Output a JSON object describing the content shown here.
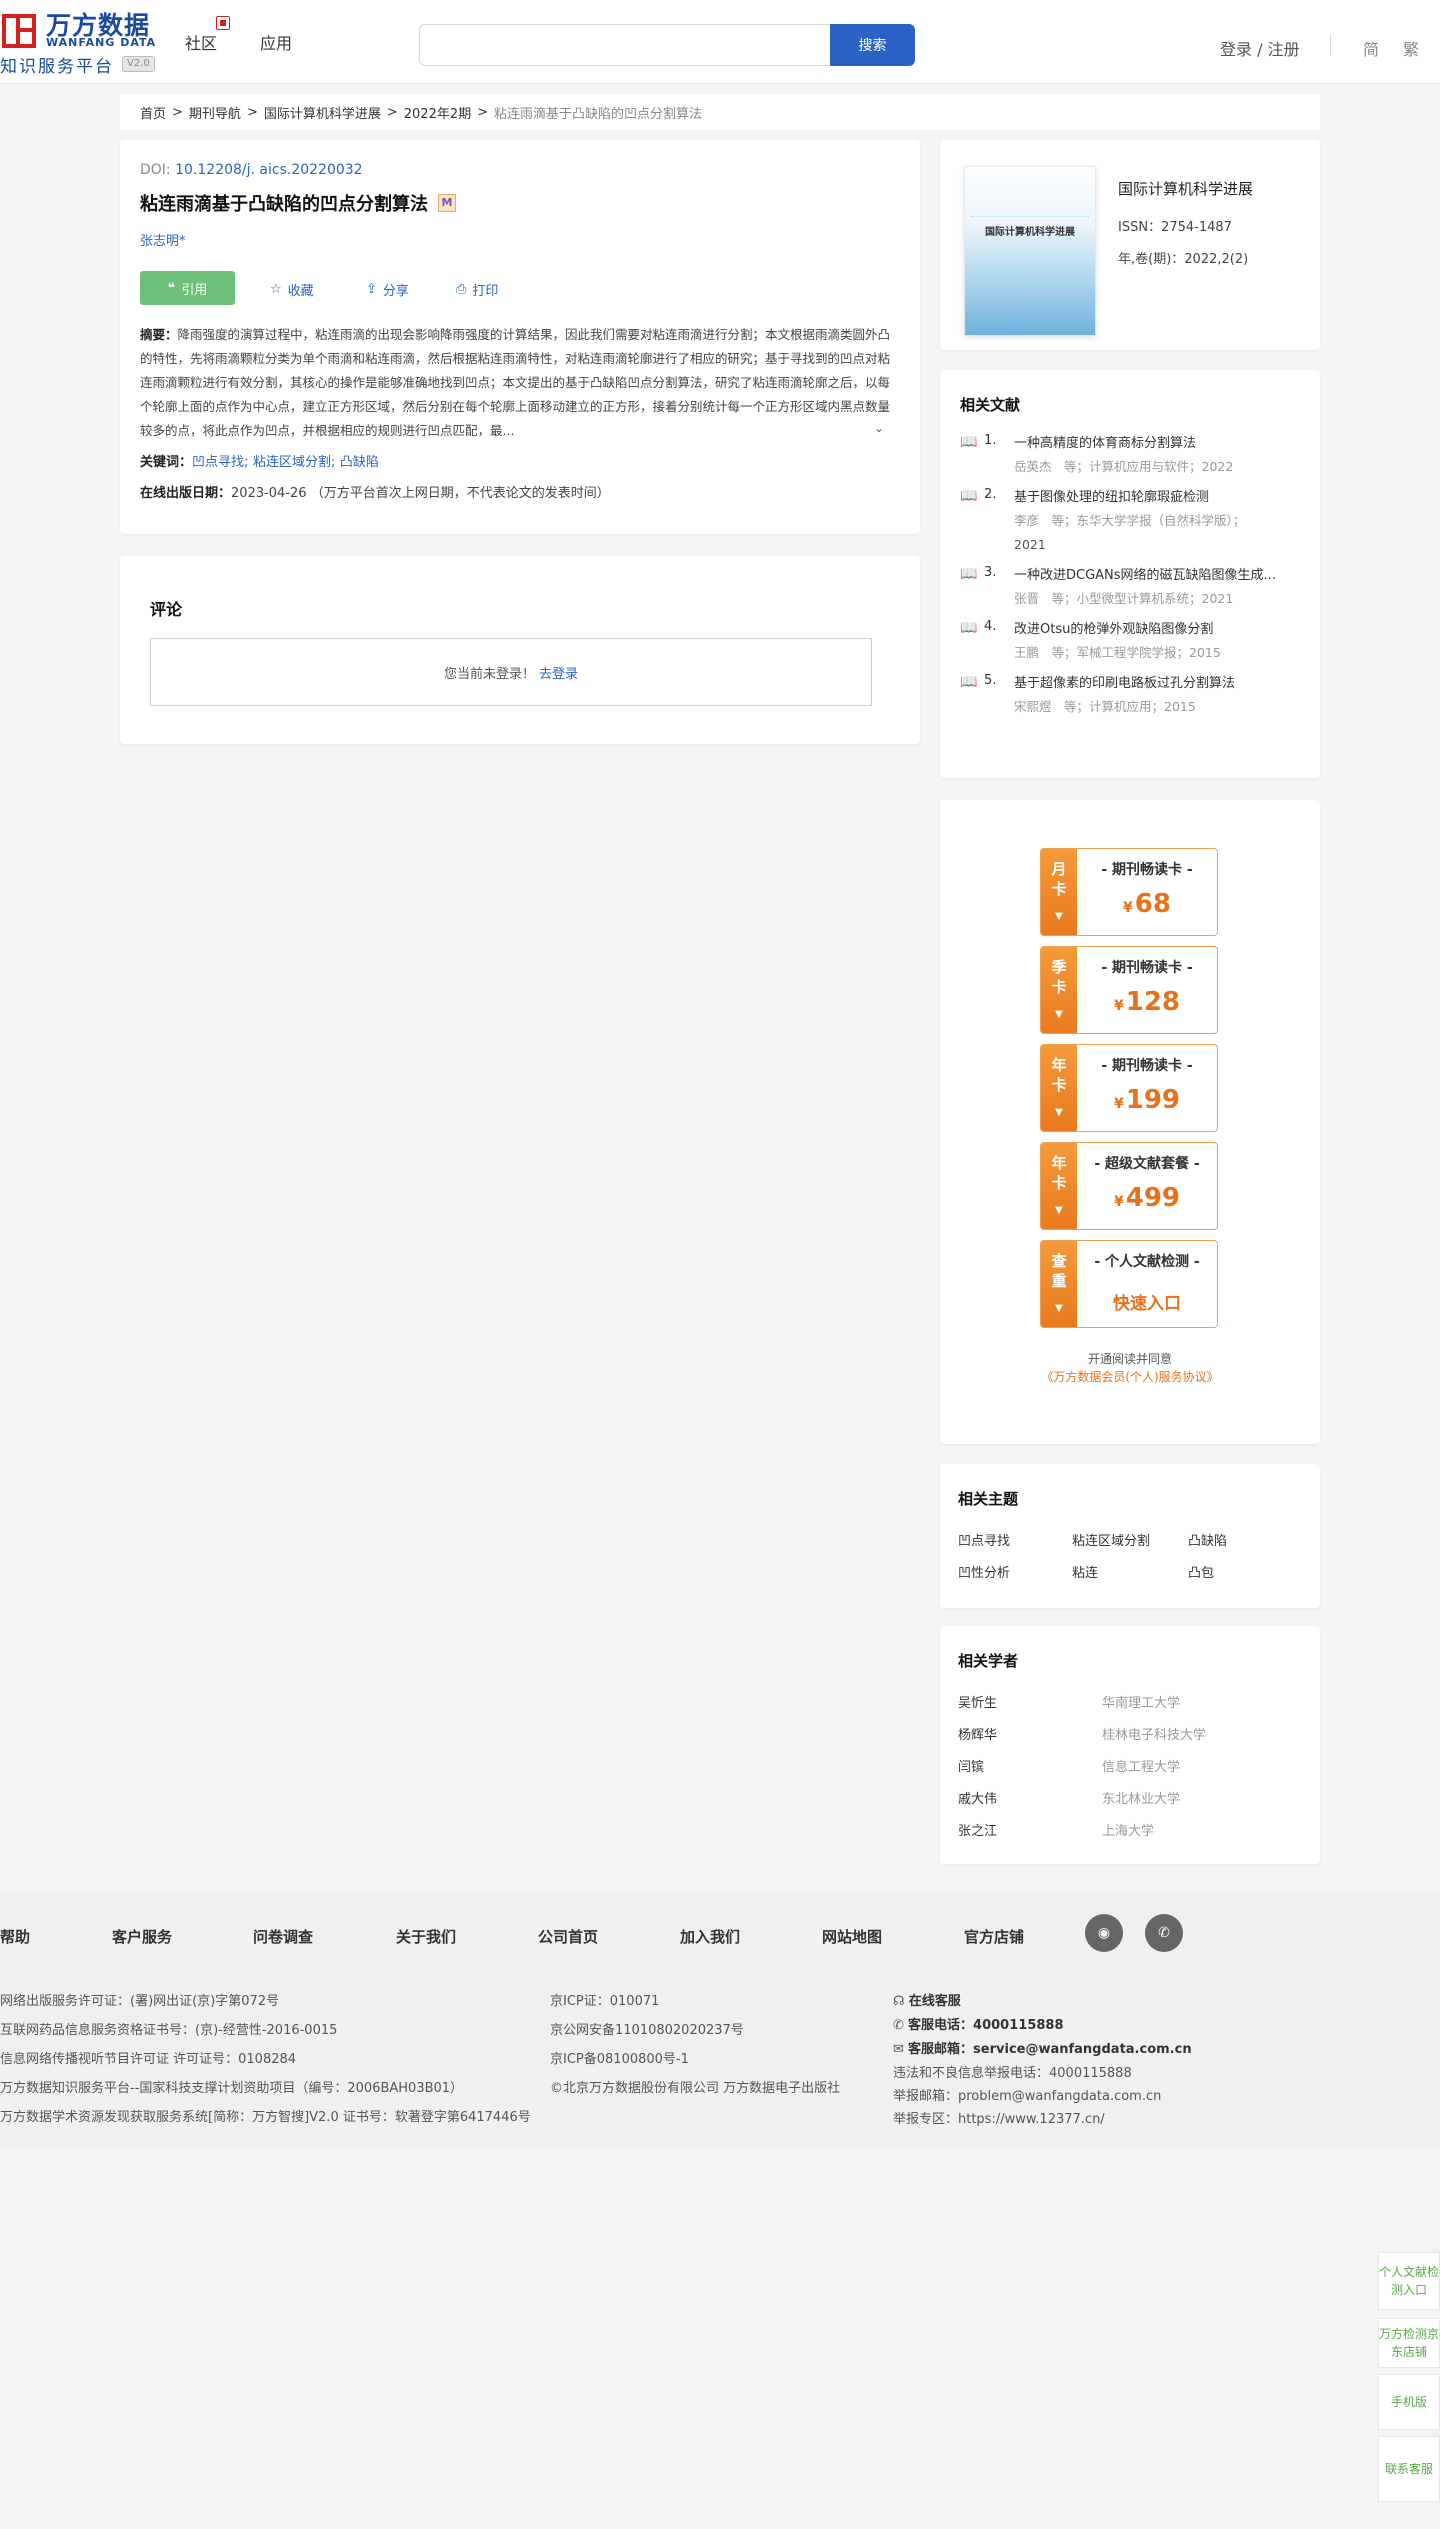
{
  "header": {
    "logo_cn": "万方数据",
    "logo_en": "WANFANG DATA",
    "logo_sub": "知识服务平台",
    "logo_version": "V2.0",
    "nav": {
      "community": "社区",
      "apps": "应用"
    },
    "search": {
      "placeholder": "",
      "button": "搜索"
    },
    "login": "登录 / 注册",
    "lang_simplified": "简",
    "lang_traditional": "繁"
  },
  "breadcrumb": [
    "首页",
    "期刊导航",
    "国际计算机科学进展",
    "2022年2期",
    "粘连雨滴基于凸缺陷的凹点分割算法"
  ],
  "article": {
    "doi_label": "DOI: ",
    "doi": "10.12208/j. aics.20220032",
    "title": "粘连雨滴基于凸缺陷的凹点分割算法",
    "badge": "M",
    "author": "张志明*",
    "actions": {
      "cite": "引用",
      "collect": "收藏",
      "share": "分享",
      "print": "打印"
    },
    "abstract_label": "摘要：",
    "abstract": "降雨强度的演算过程中，粘连雨滴的出现会影响降雨强度的计算结果，因此我们需要对粘连雨滴进行分割；本文根据雨滴类圆外凸的特性，先将雨滴颗粒分类为单个雨滴和粘连雨滴，然后根据粘连雨滴特性，对粘连雨滴轮廓进行了相应的研究；基于寻找到的凹点对粘连雨滴颗粒进行有效分割，其核心的操作是能够准确地找到凹点；本文提出的基于凸缺陷凹点分割算法，研究了粘连雨滴轮廓之后，以每个轮廓上面的点作为中心点，建立正方形区域，然后分别在每个轮廓上面移动建立的正方形，接着分别统计每一个正方形区域内黑点数量较多的点，将此点作为凹点，并根据相应的规则进行凹点匹配，最...",
    "keywords_label": "关键词：",
    "keywords": [
      "凹点寻找;",
      "粘连区域分割;",
      "凸缺陷"
    ],
    "pubdate_label": "在线出版日期：",
    "pubdate": "2023-04-26 （万方平台首次上网日期，不代表论文的发表时间）"
  },
  "comments": {
    "title": "评论",
    "not_logged": "您当前未登录！",
    "login_link": "去登录"
  },
  "journal": {
    "cover_title": "国际计算机科学进展",
    "name": "国际计算机科学进展",
    "issn": "ISSN：2754-1487",
    "year": "年,卷(期)：2022,2(2)"
  },
  "related_docs": {
    "title": "相关文献",
    "items": [
      {
        "num": "1.",
        "title": "一种高精度的体育商标分割算法",
        "meta": "岳英杰　等；计算机应用与软件；2022"
      },
      {
        "num": "2.",
        "title": "基于图像处理的纽扣轮廓瑕疵检测",
        "meta": "李彦　等；东华大学学报（自然科学版）；",
        "meta2": "2021"
      },
      {
        "num": "3.",
        "title": "一种改进DCGANs网络的磁瓦缺陷图像生成...",
        "meta": "张晋　等；小型微型计算机系统；2021"
      },
      {
        "num": "4.",
        "title": "改进Otsu的枪弹外观缺陷图像分割",
        "meta": "王鹏　等；军械工程学院学报；2015"
      },
      {
        "num": "5.",
        "title": "基于超像素的印刷电路板过孔分割算法",
        "meta": "宋熙煜　等；计算机应用；2015"
      }
    ]
  },
  "membership": {
    "cards": [
      {
        "side": "月卡",
        "head": "- 期刊畅读卡 -",
        "currency": "¥",
        "price": "68"
      },
      {
        "side": "季卡",
        "head": "- 期刊畅读卡 -",
        "currency": "¥",
        "price": "128"
      },
      {
        "side": "年卡",
        "head": "- 期刊畅读卡 -",
        "currency": "¥",
        "price": "199"
      },
      {
        "side": "年卡",
        "head": "- 超级文献套餐 -",
        "currency": "¥",
        "price": "499"
      },
      {
        "side": "查重",
        "head": "- 个人文献检测 -",
        "entry": "快速入口"
      }
    ],
    "note": "开通阅读并同意",
    "agreement": "《万方数据会员(个人)服务协议》"
  },
  "topics": {
    "title": "相关主题",
    "items": [
      "凹点寻找",
      "粘连区域分割",
      "凸缺陷",
      "凹性分析",
      "粘连",
      "凸包"
    ]
  },
  "scholars": {
    "title": "相关学者",
    "items": [
      {
        "name": "吴忻生",
        "org": "华南理工大学"
      },
      {
        "name": "杨辉华",
        "org": "桂林电子科技大学"
      },
      {
        "name": "闫镔",
        "org": "信息工程大学"
      },
      {
        "name": "戚大伟",
        "org": "东北林业大学"
      },
      {
        "name": "张之江",
        "org": "上海大学"
      }
    ]
  },
  "footer": {
    "nav": [
      "帮助",
      "客户服务",
      "问卷调查",
      "关于我们",
      "公司首页",
      "加入我们",
      "网站地图",
      "官方店铺"
    ],
    "col1": [
      "网络出版服务许可证：(署)网出证(京)字第072号",
      "互联网药品信息服务资格证书号：(京)-经营性-2016-0015",
      "信息网络传播视听节目许可证 许可证号：0108284",
      "万方数据知识服务平台--国家科技支撑计划资助项目（编号：2006BAH03B01）",
      "万方数据学术资源发现获取服务系统[简称：万方智搜]V2.0 证书号：软著登字第6417446号"
    ],
    "col2": [
      "京ICP证：010071",
      "京公网安备11010802020237号",
      "京ICP备08100800号-1",
      "©北京万方数据股份有限公司 万方数据电子出版社"
    ],
    "col3": {
      "online": "在线客服",
      "phone_label": "客服电话：",
      "phone": "4000115888",
      "email_label": "客服邮箱：",
      "email": "service@wanfangdata.com.cn",
      "report_phone": "违法和不良信息举报电话：4000115888",
      "report_email": "举报邮箱：problem@wanfangdata.com.cn",
      "report_site": "举报专区：https://www.12377.cn/"
    }
  },
  "float_bar": {
    "personal_check": "个人文献检测入口",
    "jd_store": "万方检测京东店铺",
    "mobile": "手机版",
    "contact": "联系客服"
  }
}
